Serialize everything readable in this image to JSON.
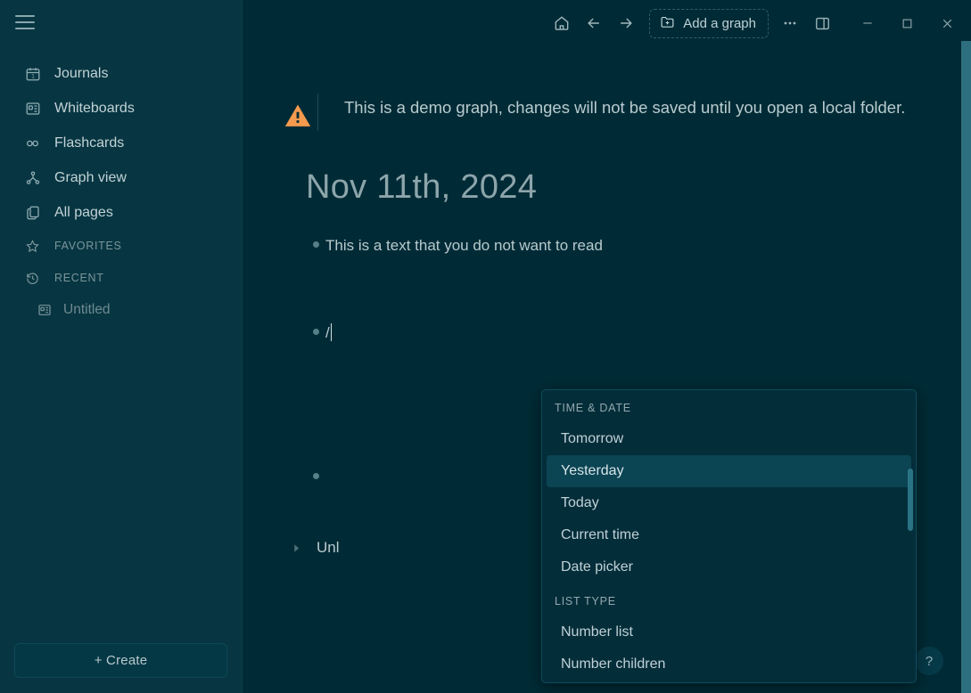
{
  "sidebar": {
    "menu_toggle": "menu-toggle",
    "nav_items": [
      {
        "label": "Journals",
        "icon": "calendar-icon"
      },
      {
        "label": "Whiteboards",
        "icon": "whiteboard-icon"
      },
      {
        "label": "Flashcards",
        "icon": "infinity-icon"
      },
      {
        "label": "Graph view",
        "icon": "graph-icon"
      },
      {
        "label": "All pages",
        "icon": "pages-icon"
      }
    ],
    "sections": [
      {
        "label": "FAVORITES",
        "icon": "star-icon"
      },
      {
        "label": "RECENT",
        "icon": "history-icon"
      }
    ],
    "recent_items": [
      {
        "label": "Untitled",
        "icon": "whiteboard-icon"
      }
    ],
    "create_button": "+ Create"
  },
  "toolbar": {
    "home_label": "home-icon",
    "back_label": "arrow-left-icon",
    "forward_label": "arrow-right-icon",
    "add_graph_label": "Add a graph",
    "more_label": "more-options-icon",
    "right_sidebar_label": "right-sidebar-icon",
    "minimize_label": "minimize-icon",
    "maximize_label": "maximize-icon",
    "close_label": "close-icon"
  },
  "banner": {
    "text": "This is a demo graph, changes will not be saved until you open a local folder.",
    "icon": "warning-triangle-icon",
    "icon_color": "#f59a4e"
  },
  "page": {
    "title": "Nov 11th, 2024",
    "blocks": [
      {
        "text": "This is a text that you do not want to read"
      },
      {
        "text": "/"
      },
      {
        "text": ""
      }
    ],
    "collapsed_block": {
      "text": "Unl",
      "arrow": "chevron-right-icon"
    }
  },
  "slash_menu": {
    "groups": [
      {
        "label": "TIME & DATE",
        "items": [
          {
            "label": "Tomorrow",
            "selected": false
          },
          {
            "label": "Yesterday",
            "selected": true
          },
          {
            "label": "Today",
            "selected": false
          },
          {
            "label": "Current time",
            "selected": false
          },
          {
            "label": "Date picker",
            "selected": false
          }
        ]
      },
      {
        "label": "LIST TYPE",
        "items": [
          {
            "label": "Number list",
            "selected": false
          },
          {
            "label": "Number children",
            "selected": false
          }
        ]
      }
    ]
  },
  "help": {
    "label": "?"
  },
  "colors": {
    "sidebar_bg": "#073642",
    "main_bg": "#002b36",
    "menu_bg": "#042d3a",
    "accent": "#2d6f7e",
    "warning": "#f59a4e",
    "text_primary": "#b8cace",
    "text_muted": "#7b949b"
  }
}
